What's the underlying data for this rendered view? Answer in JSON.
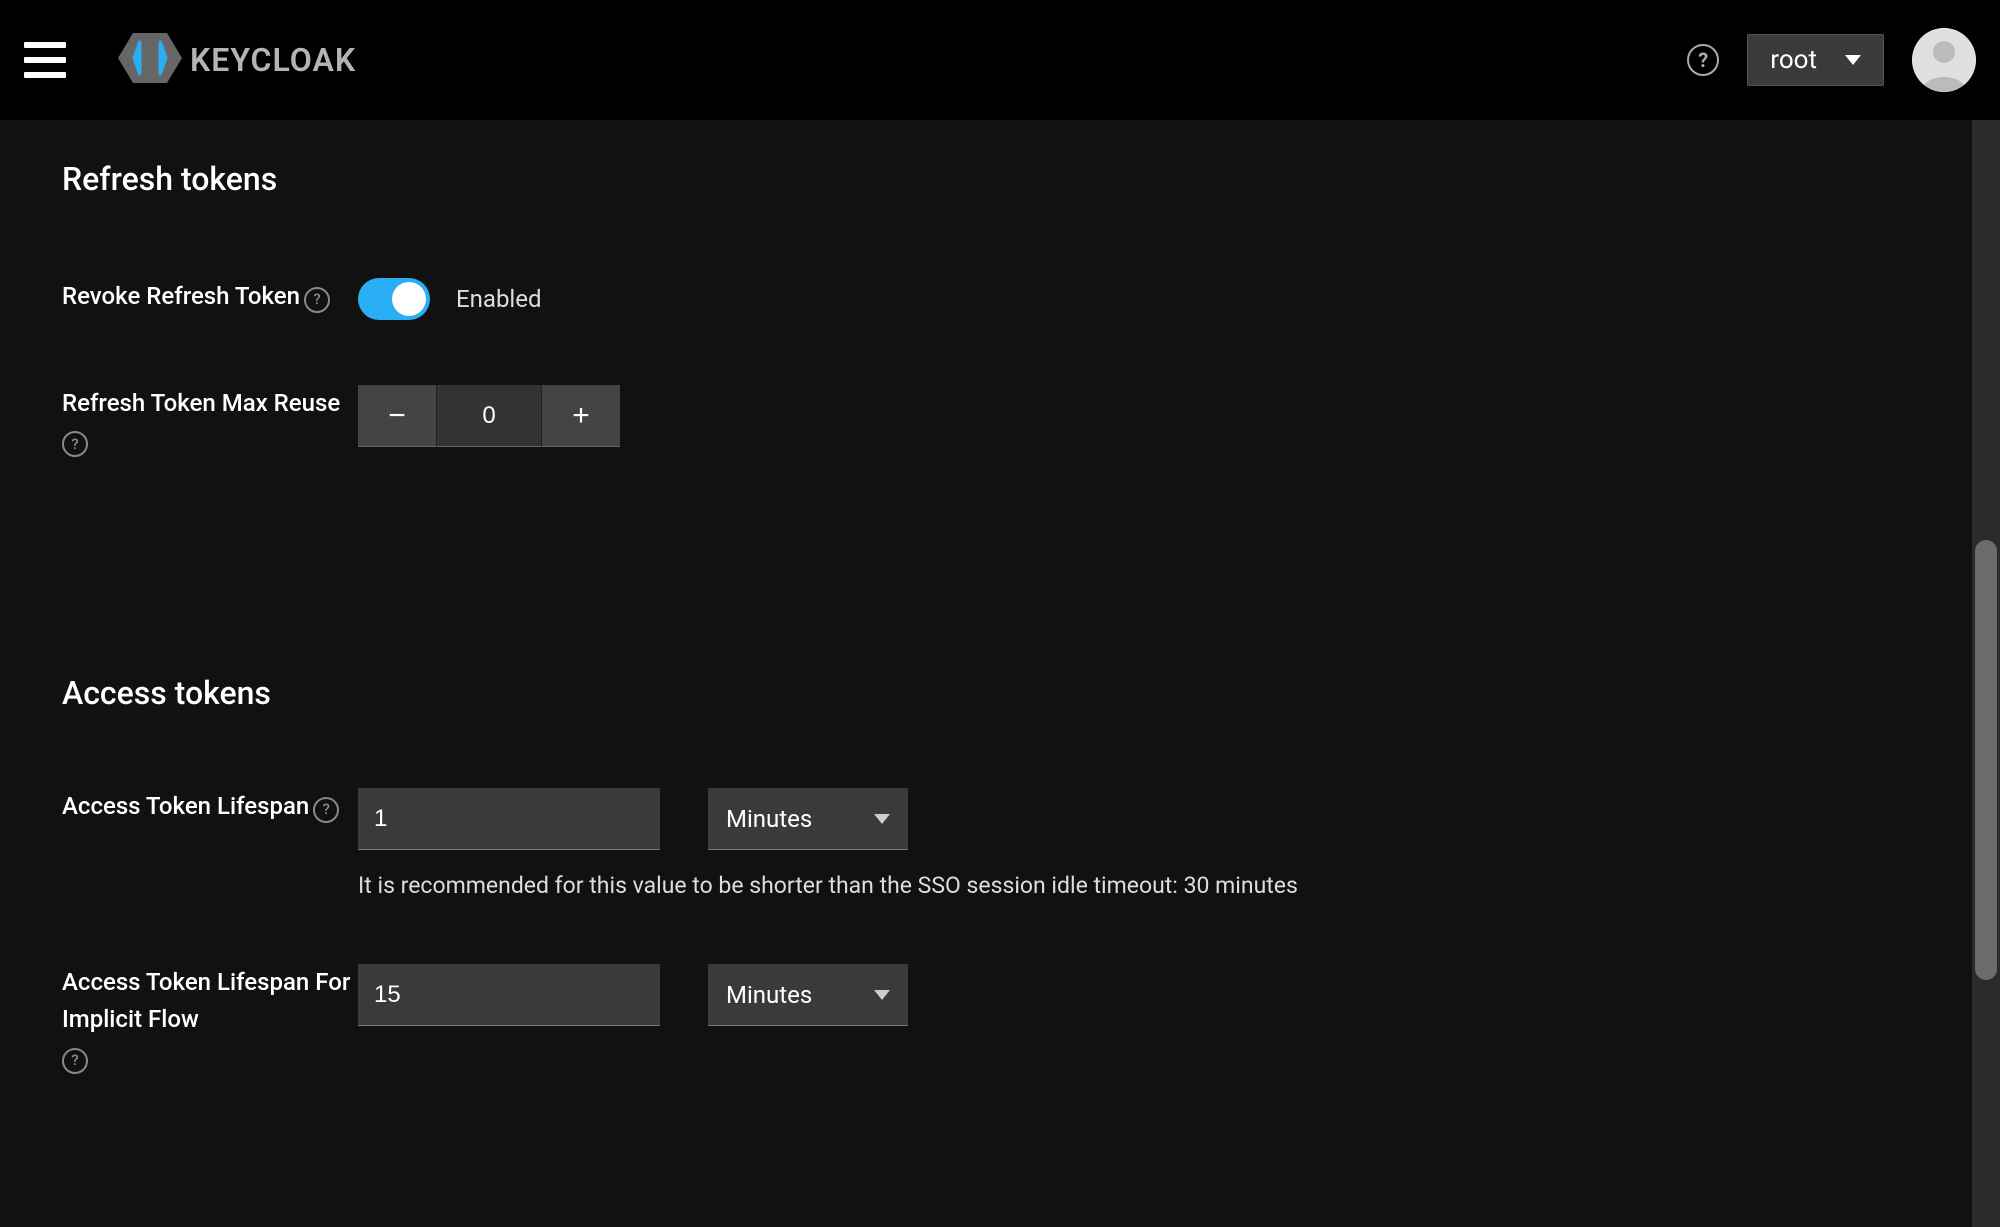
{
  "header": {
    "brand_text": "KEYCLOAK",
    "realm_label": "root"
  },
  "sections": {
    "refresh": {
      "title": "Refresh tokens",
      "revoke": {
        "label": "Revoke Refresh Token",
        "state_label": "Enabled"
      },
      "max_reuse": {
        "label": "Refresh Token Max Reuse",
        "value": "0"
      }
    },
    "access": {
      "title": "Access tokens",
      "lifespan": {
        "label": "Access Token Lifespan",
        "value": "1",
        "unit": "Minutes",
        "helper": "It is recommended for this value to be shorter than the SSO session idle timeout: 30 minutes"
      },
      "lifespan_implicit": {
        "label": "Access Token Lifespan For Implicit Flow",
        "value": "15",
        "unit": "Minutes"
      }
    }
  }
}
